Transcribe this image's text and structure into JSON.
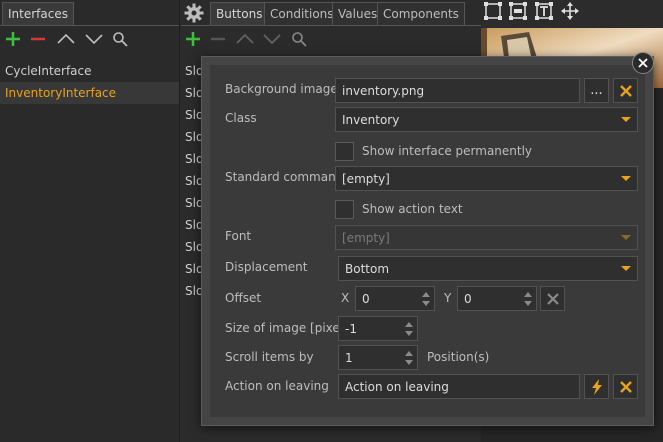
{
  "left": {
    "tab_label": "Interfaces",
    "items": [
      {
        "label": "CycleInterface"
      },
      {
        "label": "InventoryInterface"
      }
    ]
  },
  "middle": {
    "tabs": [
      "Buttons",
      "Conditions",
      "Values",
      "Components"
    ],
    "slot_prefix": "Slo"
  },
  "dialog": {
    "background_image_label": "Background image",
    "background_image_value": "inventory.png",
    "browse_label": "...",
    "class_label": "Class",
    "class_value": "Inventory",
    "show_permanently_label": "Show interface permanently",
    "standard_command_label": "Standard command",
    "standard_command_value": "[empty]",
    "show_action_text_label": "Show action text",
    "font_label": "Font",
    "font_value": "[empty]",
    "displacement_label": "Displacement",
    "displacement_value": "Bottom",
    "offset_label": "Offset",
    "offset_x_label": "X",
    "offset_x_value": "0",
    "offset_y_label": "Y",
    "offset_y_value": "0",
    "size_label": "Size of image [pixel]",
    "size_value": "-1",
    "scroll_label": "Scroll items by",
    "scroll_value": "1",
    "scroll_unit": "Position(s)",
    "action_label": "Action on leaving",
    "action_value": "Action on leaving"
  },
  "colors": {
    "accent": "#e8a21c",
    "add": "#3fbf3f",
    "remove": "#d23a3a"
  }
}
